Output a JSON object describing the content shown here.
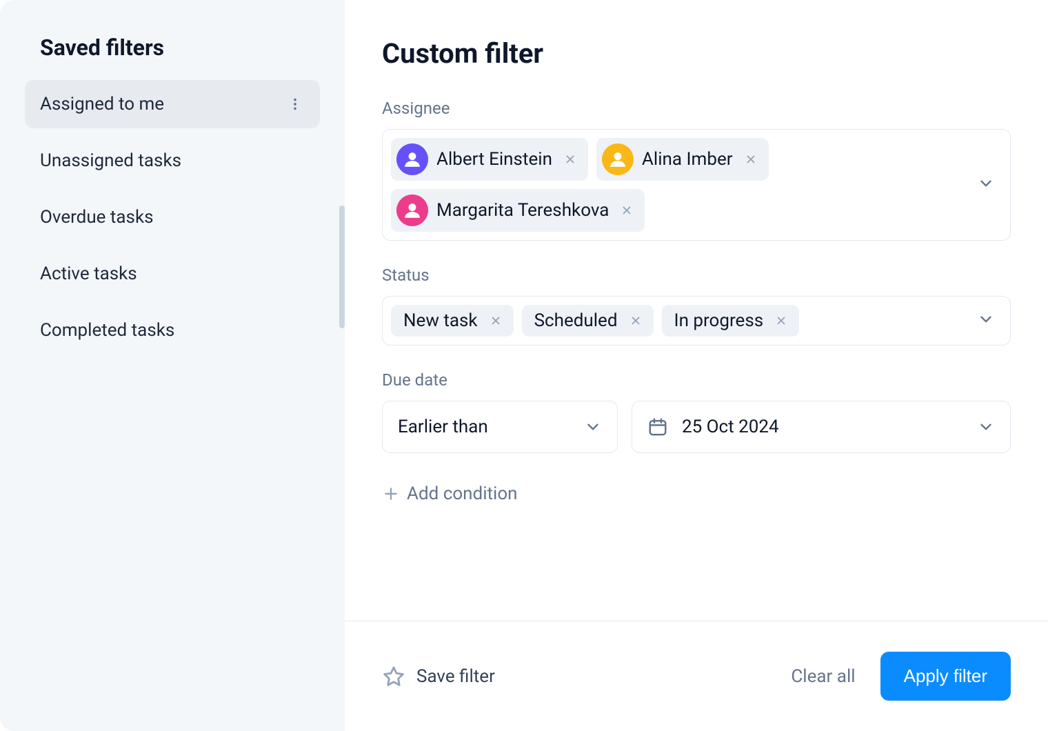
{
  "sidebar": {
    "title": "Saved filters",
    "items": [
      {
        "label": "Assigned to me",
        "active": true
      },
      {
        "label": "Unassigned tasks",
        "active": false
      },
      {
        "label": "Overdue tasks",
        "active": false
      },
      {
        "label": "Active tasks",
        "active": false
      },
      {
        "label": "Completed tasks",
        "active": false
      }
    ]
  },
  "main": {
    "title": "Custom filter",
    "assignee": {
      "label": "Assignee",
      "chips": [
        {
          "name": "Albert Einstein",
          "avatar_color": "#6650fa"
        },
        {
          "name": "Alina Imber",
          "avatar_color": "#fab818"
        },
        {
          "name": "Margarita Tereshkova",
          "avatar_color": "#ec3d8c"
        }
      ]
    },
    "status": {
      "label": "Status",
      "chips": [
        {
          "name": "New task"
        },
        {
          "name": "Scheduled"
        },
        {
          "name": "In progress"
        }
      ]
    },
    "due_date": {
      "label": "Due date",
      "operator": "Earlier than",
      "value": "25 Oct 2024"
    },
    "add_condition_label": "Add condition"
  },
  "footer": {
    "save_label": "Save filter",
    "clear_label": "Clear all",
    "apply_label": "Apply filter"
  }
}
